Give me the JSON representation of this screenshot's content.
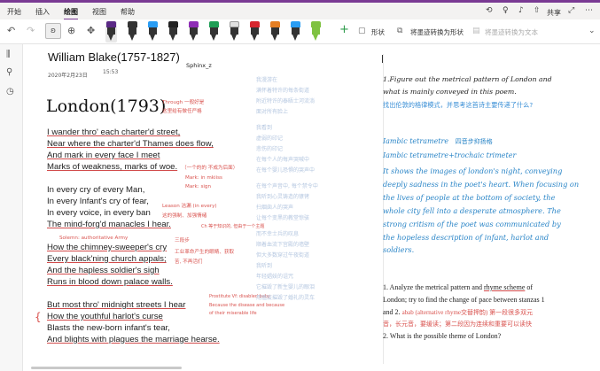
{
  "ribbon": {
    "tabs": [
      "开始",
      "插入",
      "绘图",
      "视图",
      "帮助"
    ],
    "active_tab": "绘图",
    "share_label": "共享"
  },
  "toolbar": {
    "shapes_label": "形状",
    "ink_to_shape_label": "将墨迹转换为形状",
    "ink_to_text_label": "将墨迹转换为文本",
    "pen_colors": [
      "#5b2a86",
      "#333333",
      "#2a9df4",
      "#222222",
      "#8e2db5",
      "#1f9e55",
      "#d7262e",
      "#e67e22",
      "#2a9df4",
      "#7fc241"
    ]
  },
  "page": {
    "title": "William Blake(1757-1827)",
    "date": "2020年2月23日",
    "time": "15:53",
    "author": "Sphinx_z",
    "handwritten_title": "London(1793)",
    "poem": [
      [
        "I wander thro' each charter'd street,",
        "Near where the charter'd Thames does flow,",
        "And mark in every face I meet",
        "Marks of weakness, marks of woe."
      ],
      [
        "In every cry of every Man,",
        "In every Infant's cry of fear,",
        "In every voice, in every ban",
        "The mind-forg'd manacles I hear."
      ],
      [
        "How the chimney-sweeper's cry",
        "Every black'ning church appals;",
        "And the hapless soldier's sigh",
        "Runs in blood down palace walls."
      ],
      [
        "But most thro' midnight streets I hear",
        "How the youthful harlot's curse",
        "Blasts the new-born infant's tear,",
        "And blights with plagues the marriage hearse."
      ]
    ],
    "annotations": {
      "through": "Through 一般好是",
      "through2": "这里给有做任严格",
      "woe": "（一个的的 不成为后面）",
      "mark1": "Mark: in mkiiss",
      "mark2": "Mark: sign",
      "leason1": "Leason 洁漏 (in every)",
      "leason2": "这的强制、加强情绪",
      "cn_caption": "Ch 等于知识的, 但由于一个主题",
      "solemn": "Solemn: authoritative Army",
      "s1": "三段步",
      "s2": "工业革命产生的眼睛、获取",
      "s3": "苦, 不再活们",
      "prostitute1": "Prostitute   Vf: disabled baby",
      "prostitute2": "Because the disease and because",
      "prostitute3": "of their miserable life"
    },
    "faint_cn": [
      "我漫游在",
      "满怀着特许的每条街道",
      "附近特许的泰晤士河流淌",
      "面对所有脸上",
      "我看到",
      "虚弱的印记",
      "悲伤的印记",
      "在每个人的每声哭喊中",
      "在每个婴儿恐惧的哭声中",
      "在每个声音中, 每个禁令中",
      "我听到心灵铸造的镣铐",
      "扫烟囱人的哭声",
      "让每个变黑的教堂惊骇",
      "而不幸士兵的叹息",
      "顺着血流下宫殿的墙壁",
      "但大多数穿过午夜街道",
      "我听到",
      "年轻娼妓的诅咒",
      "它摧毁了新生婴儿的眼泪",
      "用瘟疫摧毁了婚礼的灵车"
    ],
    "right": {
      "q1": "1.Figure out the metrical pattern of London and",
      "q1b": "what is mainly conveyed in this poem.",
      "q1_cn": "找出伦敦的格律模式，并思考这首诗主要传递了什么?",
      "meter1": "Iambic tetrametre",
      "meter1_cn": "四音步抑扬格",
      "meter2": "Iambic tetrametre+trochaic trimeter",
      "body": [
        "It shows the images of london's night, conveying",
        "deeply sadness in the poet's heart. When focusing on",
        "the lives of people at the bottom of society, the",
        "whole city fell into a desperate atmosphere. The",
        "strong critism of the poet was communicated by",
        "the hopeless description of infant, harlot and",
        "soldiers."
      ],
      "a1": "1.   Analyze the metrical pattern and",
      "a1_rhyme": "rhyme scheme",
      "a1_of": "of",
      "a1b": "London; try to find the change of pace between stanzas 1",
      "a1c_pre": "and 2.",
      "a1c_red": "abab (alternative rhyme交替押韵)   第一段很多双元",
      "a1d_red": "音，长元音，要缓读；第二段因为连续和重要可以读快",
      "a2": "2.   What is the possible theme of London?"
    }
  }
}
